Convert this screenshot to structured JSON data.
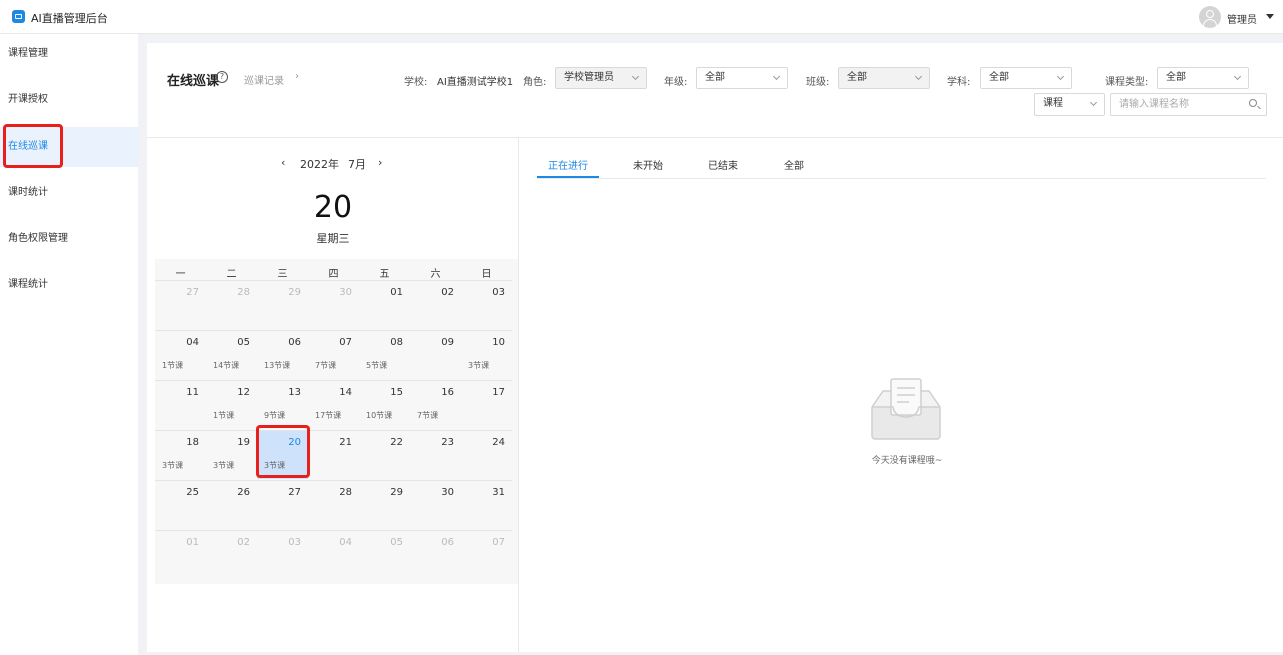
{
  "app": {
    "title": "AI直播管理后台",
    "user": "管理员"
  },
  "sidebar": {
    "items": [
      {
        "label": "课程管理"
      },
      {
        "label": "开课授权"
      },
      {
        "label": "在线巡课"
      },
      {
        "label": "课时统计"
      },
      {
        "label": "角色权限管理"
      },
      {
        "label": "课程统计"
      }
    ]
  },
  "header": {
    "title": "在线巡课",
    "records_link": "巡课记录",
    "records_arrow": "›",
    "help": "?",
    "filters": {
      "school_label": "学校:",
      "school_value": "AI直播测试学校1",
      "role_label": "角色:",
      "role_value": "学校管理员",
      "grade_label": "年级:",
      "grade_value": "全部",
      "class_label": "班级:",
      "class_value": "全部",
      "subject_label": "学科:",
      "subject_value": "全部",
      "course_type_label": "课程类型:",
      "course_type_value": "全部",
      "search_scope": "课程",
      "search_placeholder": "请输入课程名称"
    }
  },
  "calendar": {
    "year": "2022年",
    "month": "7月",
    "prev": "‹",
    "next": "›",
    "selected_day": "20",
    "selected_weekday": "星期三",
    "weekdays": [
      "一",
      "二",
      "三",
      "四",
      "五",
      "六",
      "日"
    ],
    "days": [
      {
        "d": "27",
        "other": true,
        "c": ""
      },
      {
        "d": "28",
        "other": true,
        "c": ""
      },
      {
        "d": "29",
        "other": true,
        "c": ""
      },
      {
        "d": "30",
        "other": true,
        "c": ""
      },
      {
        "d": "01",
        "c": ""
      },
      {
        "d": "02",
        "c": ""
      },
      {
        "d": "03",
        "c": ""
      },
      {
        "d": "04",
        "c": "1节课"
      },
      {
        "d": "05",
        "c": "14节课"
      },
      {
        "d": "06",
        "c": "13节课"
      },
      {
        "d": "07",
        "c": "7节课"
      },
      {
        "d": "08",
        "c": "5节课"
      },
      {
        "d": "09",
        "c": ""
      },
      {
        "d": "10",
        "c": "3节课"
      },
      {
        "d": "11",
        "c": ""
      },
      {
        "d": "12",
        "c": "1节课"
      },
      {
        "d": "13",
        "c": "9节课"
      },
      {
        "d": "14",
        "c": "17节课"
      },
      {
        "d": "15",
        "c": "10节课"
      },
      {
        "d": "16",
        "c": "7节课"
      },
      {
        "d": "17",
        "c": ""
      },
      {
        "d": "18",
        "c": "3节课"
      },
      {
        "d": "19",
        "c": "3节课"
      },
      {
        "d": "20",
        "c": "3节课",
        "selected": true
      },
      {
        "d": "21",
        "c": ""
      },
      {
        "d": "22",
        "c": ""
      },
      {
        "d": "23",
        "c": ""
      },
      {
        "d": "24",
        "c": ""
      },
      {
        "d": "25",
        "c": ""
      },
      {
        "d": "26",
        "c": ""
      },
      {
        "d": "27",
        "c": ""
      },
      {
        "d": "28",
        "c": ""
      },
      {
        "d": "29",
        "c": ""
      },
      {
        "d": "30",
        "c": ""
      },
      {
        "d": "31",
        "c": ""
      },
      {
        "d": "01",
        "other": true,
        "c": ""
      },
      {
        "d": "02",
        "other": true,
        "c": ""
      },
      {
        "d": "03",
        "other": true,
        "c": ""
      },
      {
        "d": "04",
        "other": true,
        "c": ""
      },
      {
        "d": "05",
        "other": true,
        "c": ""
      },
      {
        "d": "06",
        "other": true,
        "c": ""
      },
      {
        "d": "07",
        "other": true,
        "c": ""
      }
    ]
  },
  "tabs": [
    {
      "label": "正在进行",
      "active": true
    },
    {
      "label": "未开始"
    },
    {
      "label": "已结束"
    },
    {
      "label": "全部"
    }
  ],
  "empty": {
    "text": "今天没有课程哦~"
  },
  "colors": {
    "accent": "#1e88e5",
    "highlight": "#e8201c",
    "selected_cell": "#cfe2fb"
  }
}
